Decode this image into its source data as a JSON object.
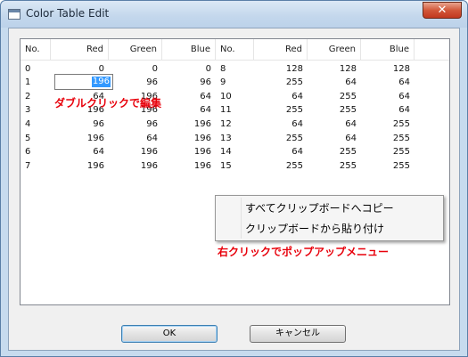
{
  "window": {
    "title": "Color Table Edit",
    "close_glyph": "✕"
  },
  "table": {
    "headers": [
      "No.",
      "Red",
      "Green",
      "Blue",
      "No.",
      "Red",
      "Green",
      "Blue"
    ],
    "rows": [
      [
        "0",
        "0",
        "0",
        "0",
        "8",
        "128",
        "128",
        "128"
      ],
      [
        "1",
        "",
        "96",
        "96",
        "9",
        "255",
        "64",
        "64"
      ],
      [
        "2",
        "64",
        "196",
        "64",
        "10",
        "64",
        "255",
        "64"
      ],
      [
        "3",
        "196",
        "196",
        "64",
        "11",
        "255",
        "255",
        "64"
      ],
      [
        "4",
        "96",
        "96",
        "196",
        "12",
        "64",
        "64",
        "255"
      ],
      [
        "5",
        "196",
        "64",
        "196",
        "13",
        "255",
        "64",
        "255"
      ],
      [
        "6",
        "64",
        "196",
        "196",
        "14",
        "64",
        "255",
        "255"
      ],
      [
        "7",
        "196",
        "196",
        "196",
        "15",
        "255",
        "255",
        "255"
      ]
    ],
    "editing_value": "196"
  },
  "annotations": {
    "double_click": "ダブルクリックで編集",
    "right_click": "右クリックでポップアップメニュー"
  },
  "context_menu": {
    "items": [
      "すべてクリップボードへコピー",
      "クリップボードから貼り付け"
    ]
  },
  "buttons": {
    "ok": "OK",
    "cancel": "キャンセル"
  },
  "colors": {
    "annotation": "#e8000b",
    "selection": "#3399ff"
  }
}
